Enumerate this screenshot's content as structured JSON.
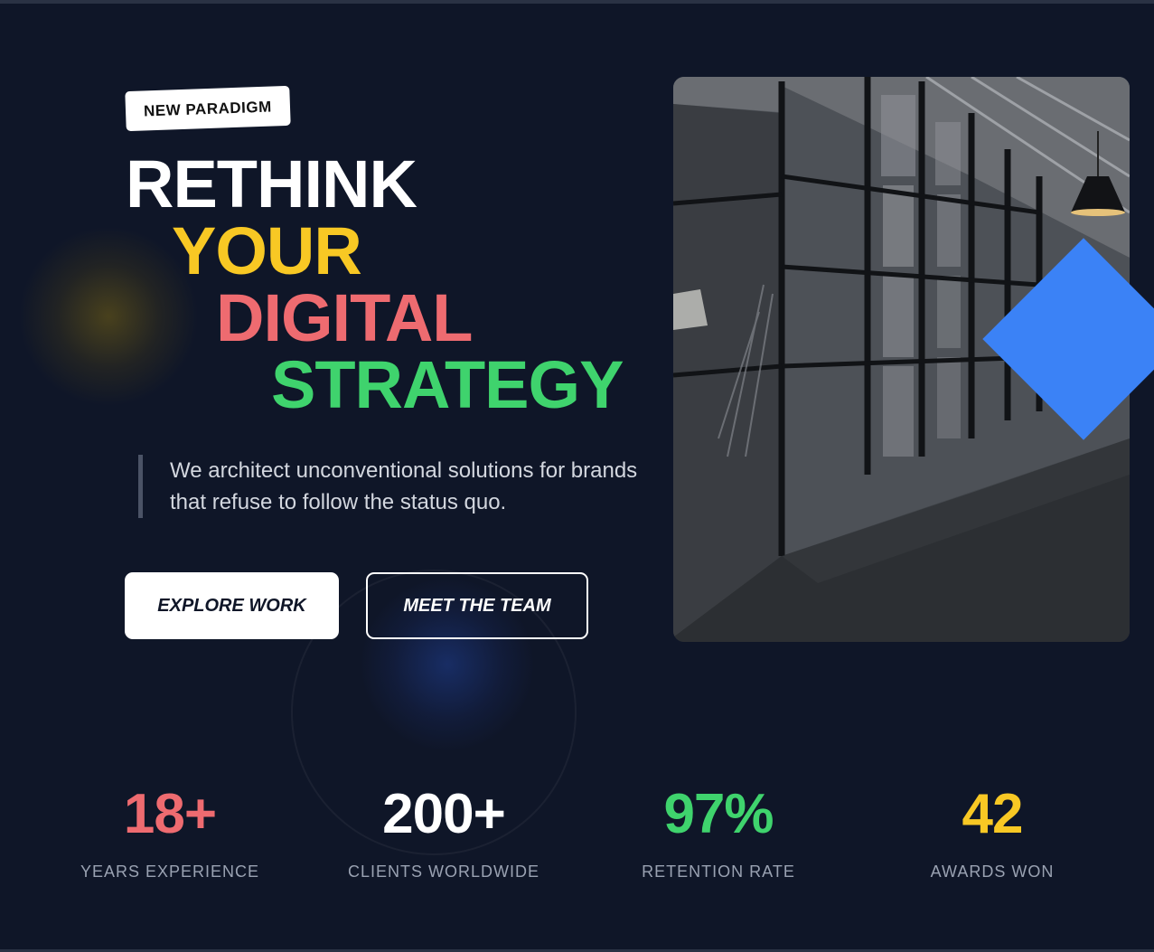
{
  "hero": {
    "tag": "NEW PARADIGM",
    "headline": {
      "line1": "RETHINK",
      "line2": "YOUR",
      "line3": "DIGITAL",
      "line4": "STRATEGY"
    },
    "description": "We architect unconventional solutions for brands that refuse to follow the status quo.",
    "primary_button": "EXPLORE WORK",
    "secondary_button": "MEET THE TEAM"
  },
  "colors": {
    "background": "#0f1628",
    "yellow": "#f8c824",
    "coral": "#ee6b70",
    "green": "#3fd36d",
    "blue": "#3b82f6"
  },
  "stats": [
    {
      "value": "18+",
      "label": "YEARS EXPERIENCE",
      "color": "#ee6b70"
    },
    {
      "value": "200+",
      "label": "CLIENTS WORLDWIDE",
      "color": "#ffffff"
    },
    {
      "value": "97%",
      "label": "RETENTION RATE",
      "color": "#3fd36d"
    },
    {
      "value": "42",
      "label": "AWARDS WON",
      "color": "#f8c824"
    }
  ]
}
